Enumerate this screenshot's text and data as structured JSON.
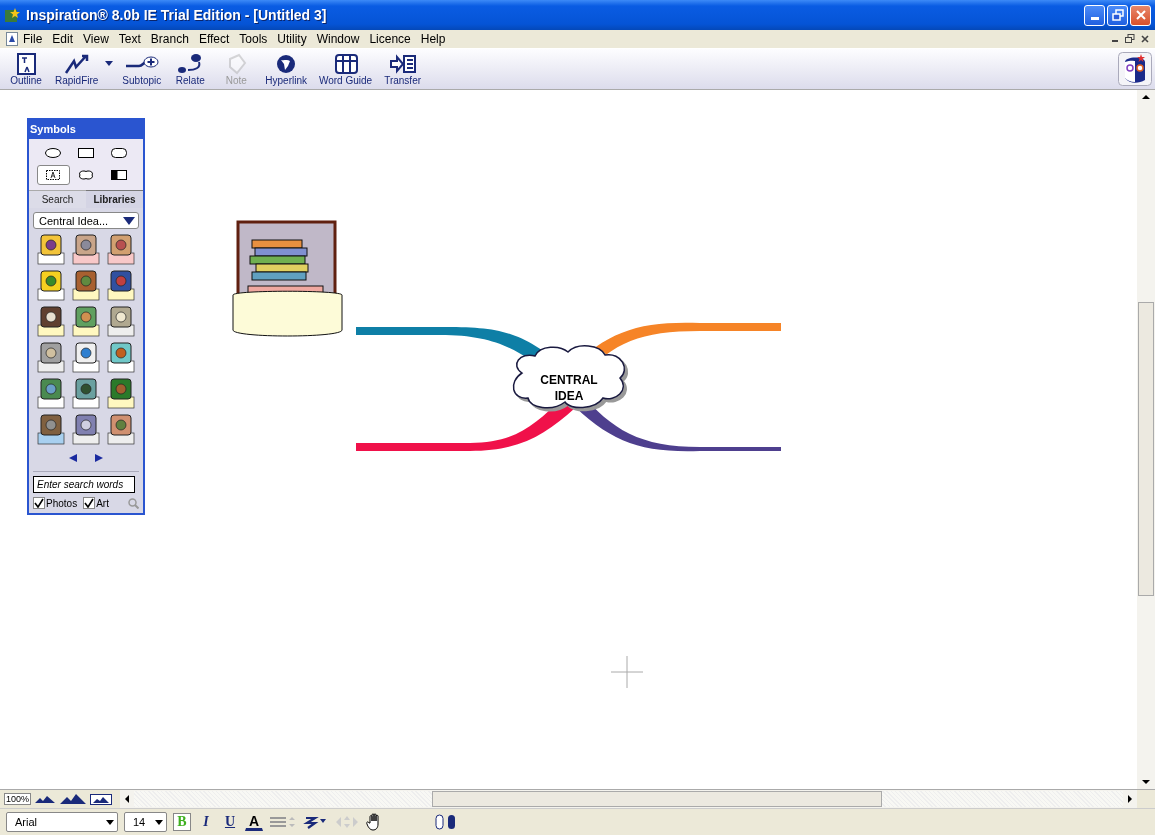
{
  "window": {
    "title": "Inspiration® 8.0b IE Trial Edition - [Untitled 3]"
  },
  "menu": [
    "File",
    "Edit",
    "View",
    "Text",
    "Branch",
    "Effect",
    "Tools",
    "Utility",
    "Window",
    "Licence",
    "Help"
  ],
  "toolbar": [
    {
      "kind": "outline",
      "label": "Outline",
      "disabled": false
    },
    {
      "kind": "rapidfire",
      "label": "RapidFire",
      "disabled": false
    },
    {
      "kind": "subtopic",
      "label": "Subtopic",
      "disabled": false
    },
    {
      "kind": "relate",
      "label": "Relate",
      "disabled": false
    },
    {
      "kind": "note",
      "label": "Note",
      "disabled": true
    },
    {
      "kind": "hyperlink",
      "label": "Hyperlink",
      "disabled": false
    },
    {
      "kind": "wordguide",
      "label": "Word Guide",
      "disabled": false
    },
    {
      "kind": "transfer",
      "label": "Transfer",
      "disabled": false
    }
  ],
  "symbols_palette": {
    "title": "Symbols",
    "shapes": [
      {
        "kind": "oval",
        "selected": false
      },
      {
        "kind": "rectangle",
        "selected": false
      },
      {
        "kind": "rounded",
        "selected": false
      },
      {
        "kind": "text",
        "selected": true
      },
      {
        "kind": "cloud",
        "selected": false
      },
      {
        "kind": "split",
        "selected": false
      }
    ],
    "tabs": [
      {
        "label": "Search",
        "selected": false
      },
      {
        "label": "Libraries",
        "selected": true
      }
    ],
    "library": "Central Idea...",
    "search": {
      "placeholder": "Enter search words"
    },
    "filters": [
      {
        "label": "Photos",
        "checked": true
      },
      {
        "label": "Art",
        "checked": true
      }
    ]
  },
  "diagram": {
    "central_idea": "CENTRAL\nIDEA",
    "branches": [
      {
        "kind": "northwest",
        "color": "#0e7fa6"
      },
      {
        "kind": "northeast",
        "color": "#f68427"
      },
      {
        "kind": "southwest",
        "color": "#f0114a"
      },
      {
        "kind": "southeast",
        "color": "#4e3f8e"
      }
    ]
  },
  "zoom": "100%",
  "format_bar": {
    "font": "Arial",
    "size": "14",
    "styles": [
      {
        "kind": "bold",
        "label": "B",
        "selected": true
      },
      {
        "kind": "italic",
        "label": "I",
        "selected": false
      },
      {
        "kind": "underline",
        "label": "U",
        "selected": false
      },
      {
        "kind": "color",
        "label": "A",
        "selected": false
      }
    ]
  }
}
